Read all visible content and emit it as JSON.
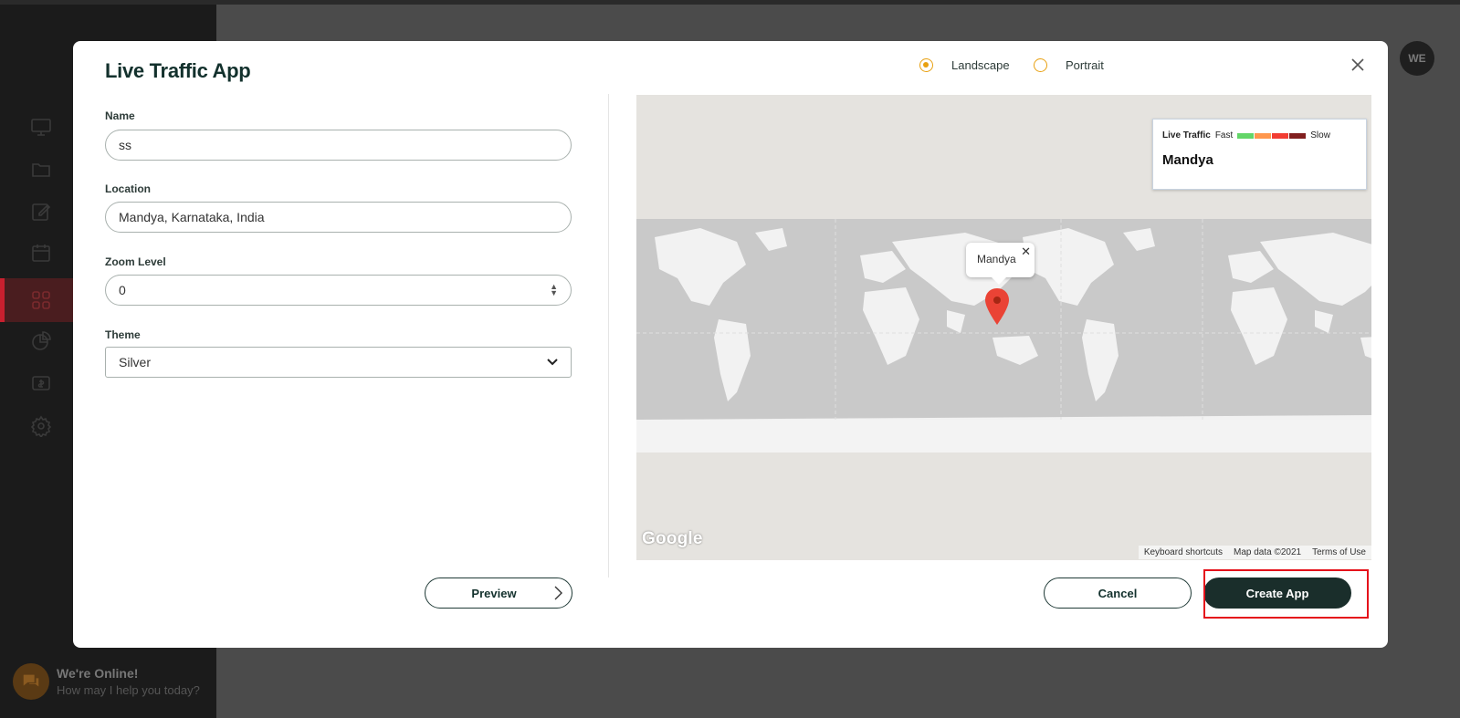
{
  "background": {
    "avatar_initials": "WE",
    "chat": {
      "title": "We're Online!",
      "subtitle": "How may I help you today?"
    },
    "sidebar_icons": [
      "monitor-icon",
      "folder-icon",
      "edit-icon",
      "calendar-icon",
      "apps-grid-icon",
      "pie-chart-icon",
      "money-icon",
      "settings-icon"
    ]
  },
  "modal": {
    "title": "Live Traffic App",
    "orientation": {
      "landscape_label": "Landscape",
      "portrait_label": "Portrait",
      "selected": "Landscape"
    },
    "form": {
      "name_label": "Name",
      "name_value": "ss",
      "location_label": "Location",
      "location_value": "Mandya, Karnataka, India",
      "zoom_label": "Zoom Level",
      "zoom_value": "0",
      "theme_label": "Theme",
      "theme_value": "Silver"
    },
    "preview_label": "Preview",
    "map": {
      "legend_title": "Live Traffic",
      "legend_fast": "Fast",
      "legend_slow": "Slow",
      "legend_colors": [
        "#63d668",
        "#ff974d",
        "#f23c32",
        "#811f1f"
      ],
      "location_name": "Mandya",
      "info_window_text": "Mandya",
      "google_logo": "Google",
      "footer": {
        "shortcuts": "Keyboard shortcuts",
        "map_data": "Map data ©2021",
        "terms": "Terms of Use"
      }
    },
    "cancel_label": "Cancel",
    "create_label": "Create App"
  },
  "colors": {
    "primary_dark": "#1a2e2b",
    "radio_accent": "#e8a010",
    "highlight": "#e5121b"
  }
}
